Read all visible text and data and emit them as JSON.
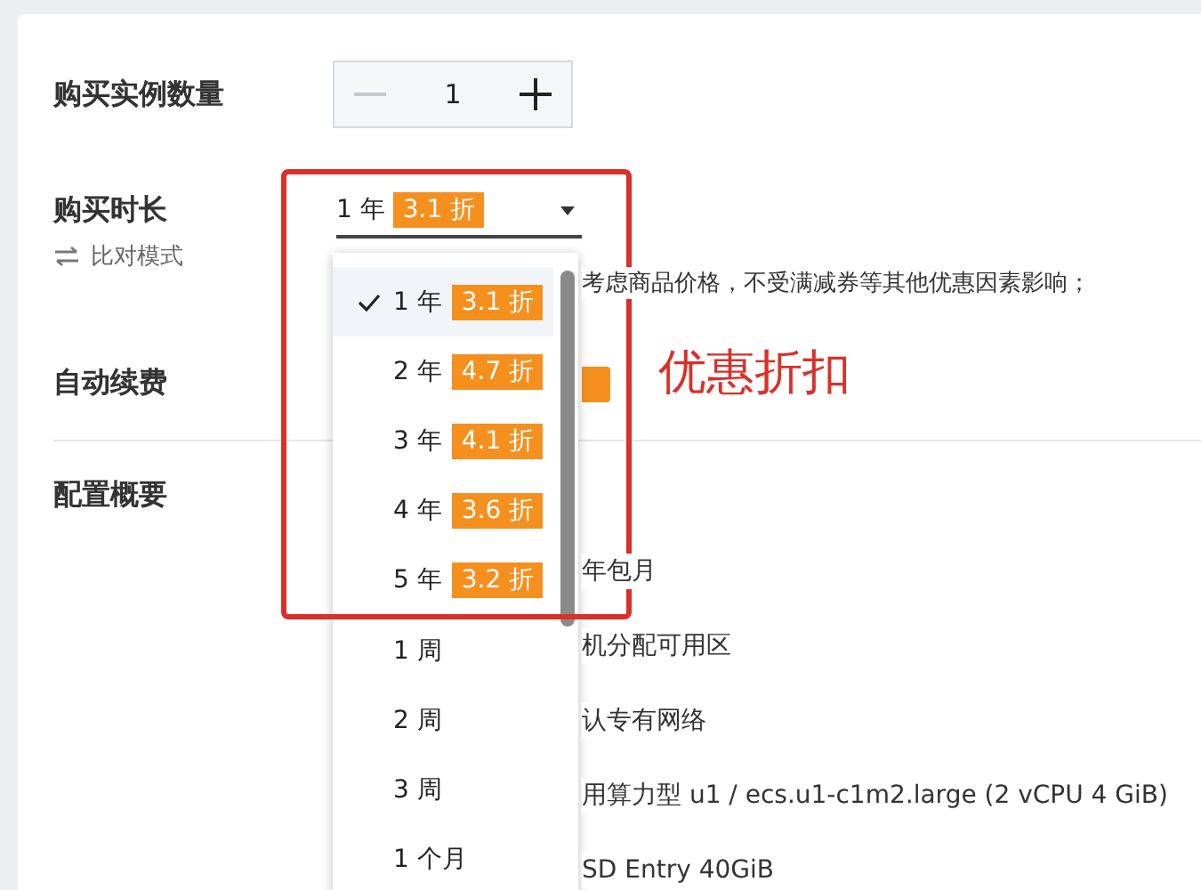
{
  "quantity": {
    "label": "购买实例数量",
    "value": "1",
    "minus_disabled": true
  },
  "duration": {
    "label": "购买时长",
    "compare_mode": "比对模式",
    "selected_value": "1 年",
    "selected_discount": "3.1 折",
    "options": [
      {
        "kind": "year",
        "label": "1 年",
        "discount": "3.1 折",
        "selected": true
      },
      {
        "kind": "year",
        "label": "2 年",
        "discount": "4.7 折",
        "selected": false
      },
      {
        "kind": "year",
        "label": "3 年",
        "discount": "4.1 折",
        "selected": false
      },
      {
        "kind": "year",
        "label": "4 年",
        "discount": "3.6 折",
        "selected": false
      },
      {
        "kind": "year",
        "label": "5 年",
        "discount": "3.2 折",
        "selected": false
      },
      {
        "kind": "plain",
        "label": "1 周",
        "selected": false
      },
      {
        "kind": "plain",
        "label": "2 周",
        "selected": false
      },
      {
        "kind": "plain",
        "label": "3 周",
        "selected": false
      },
      {
        "kind": "plain",
        "label": "1 个月",
        "selected": false
      }
    ]
  },
  "price_note": "考虑商品价格，不受满减券等其他优惠因素影响；",
  "auto_renew": {
    "label": "自动续费"
  },
  "summary": {
    "label": "配置概要",
    "rows": [
      "年包月",
      "机分配可用区",
      "认专有网络",
      "用算力型 u1 / ecs.u1-c1m2.large (2 vCPU 4 GiB)",
      "SD Entry 40GiB"
    ]
  },
  "annotation": "优惠折扣"
}
